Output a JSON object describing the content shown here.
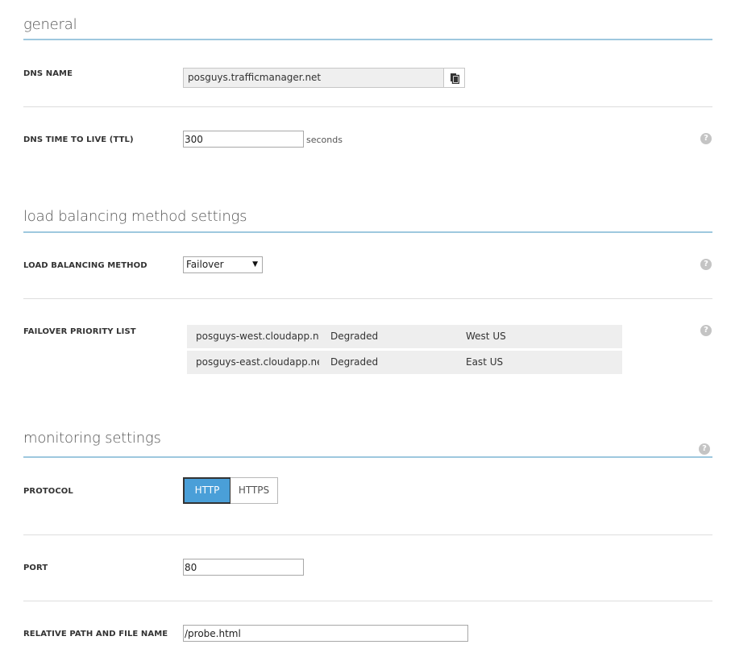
{
  "general": {
    "title": "general",
    "dns_name": {
      "label": "DNS NAME",
      "value": "posguys.trafficmanager.net"
    },
    "ttl": {
      "label": "DNS TIME TO LIVE (TTL)",
      "value": "300",
      "unit": "seconds"
    }
  },
  "load_balancing": {
    "title": "load balancing method settings",
    "method": {
      "label": "LOAD BALANCING METHOD",
      "selected": "Failover"
    },
    "priority_list": {
      "label": "FAILOVER PRIORITY LIST",
      "rows": [
        {
          "name": "posguys-west.cloudapp.net",
          "status": "Degraded",
          "region": "West US"
        },
        {
          "name": "posguys-east.cloudapp.net",
          "status": "Degraded",
          "region": "East US"
        }
      ]
    }
  },
  "monitoring": {
    "title": "monitoring settings",
    "protocol": {
      "label": "PROTOCOL",
      "options": [
        "HTTP",
        "HTTPS"
      ],
      "selected": "HTTP"
    },
    "port": {
      "label": "PORT",
      "value": "80"
    },
    "path": {
      "label": "RELATIVE PATH AND FILE NAME",
      "value": "/probe.html"
    }
  },
  "icons": {
    "help": "?",
    "copy": "copy-icon",
    "dropdown": "▼"
  },
  "colors": {
    "accent": "#4a9fd8",
    "section_rule": "#9ec8de",
    "row_bg": "#eeeeee"
  }
}
